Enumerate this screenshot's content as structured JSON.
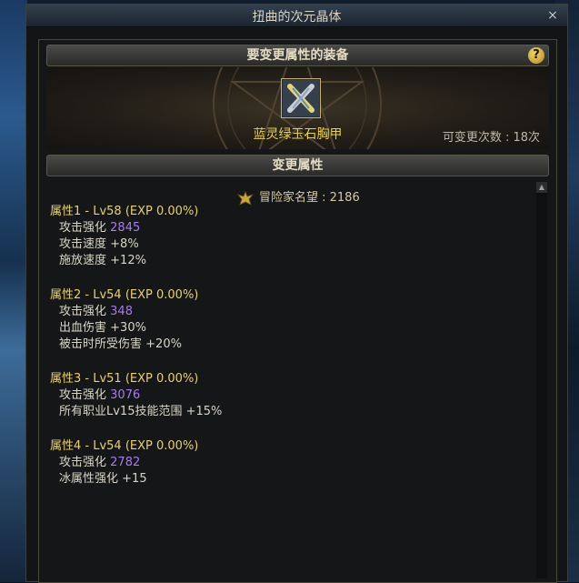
{
  "window": {
    "title": "扭曲的次元晶体",
    "close_label": "×"
  },
  "equipment_section": {
    "title": "要变更属性的装备",
    "help_label": "?",
    "item_name": "蓝灵绿玉石胸甲",
    "change_count": "可变更次数 : 18次"
  },
  "change_section": {
    "title": "变更属性"
  },
  "reputation": {
    "label": "冒险家名望 : 2186"
  },
  "properties": [
    {
      "header": "属性1 - Lv58 (EXP 0.00%)",
      "lines": [
        {
          "name": "攻击强化",
          "value": "2845"
        },
        {
          "name": "攻击速度",
          "value": "+8%"
        },
        {
          "name": "施放速度",
          "value": "+12%"
        }
      ]
    },
    {
      "header": "属性2 - Lv54 (EXP 0.00%)",
      "lines": [
        {
          "name": "攻击强化",
          "value": "348"
        },
        {
          "name": "出血伤害",
          "value": "+30%"
        },
        {
          "name": "被击时所受伤害",
          "value": "+20%"
        }
      ]
    },
    {
      "header": "属性3 - Lv51 (EXP 0.00%)",
      "lines": [
        {
          "name": "攻击强化",
          "value": "3076"
        },
        {
          "name": "所有职业Lv15技能范围",
          "value": "+15%"
        }
      ]
    },
    {
      "header": "属性4 - Lv54 (EXP 0.00%)",
      "lines": [
        {
          "name": "攻击强化",
          "value": "2782"
        },
        {
          "name": "冰属性强化",
          "value": "+15"
        }
      ]
    }
  ],
  "colors": {
    "accent_gold": "#e8cf78",
    "value_purple": "#a57cf2",
    "item_name": "#e8d04a"
  },
  "icons": {
    "item": "armor-chest-icon",
    "reputation": "reputation-emblem-icon",
    "help": "help-icon",
    "close": "close-icon"
  }
}
